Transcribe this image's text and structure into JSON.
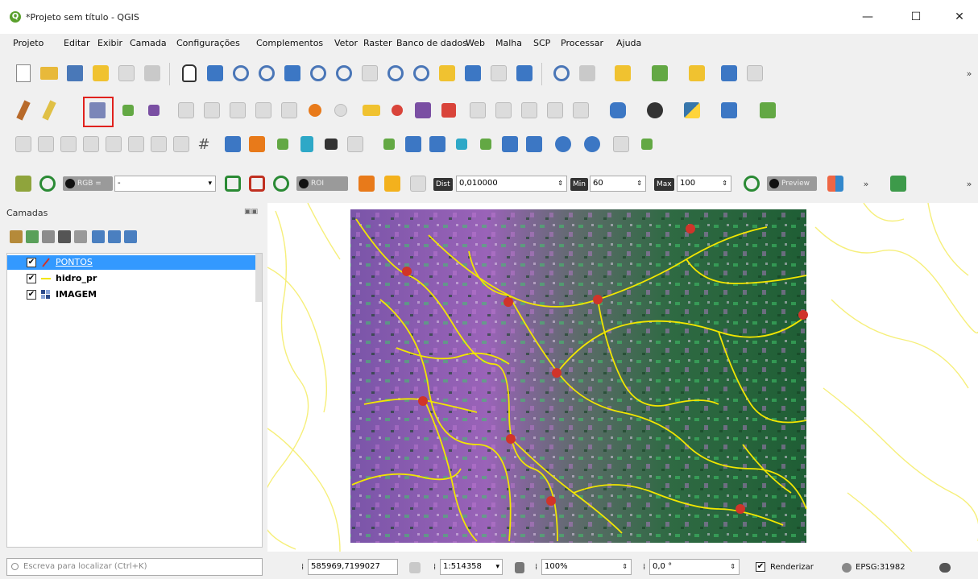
{
  "window": {
    "title": "*Projeto sem título - QGIS",
    "minimize": "—",
    "maximize": "☐",
    "close": "✕"
  },
  "menu": [
    "Projeto",
    "Editar",
    "Exibir",
    "Camada",
    "Configurações",
    "Complementos",
    "Vetor",
    "Raster",
    "Banco de dados",
    "Web",
    "Malha",
    "SCP",
    "Processar",
    "Ajuda"
  ],
  "scp_toolbar": {
    "rgb_label": "RGB =",
    "rgb_value": "-",
    "roi_label": "ROI",
    "dist_label": "Dist",
    "dist_value": "0,010000",
    "min_label": "Min",
    "min_value": "60",
    "max_label": "Max",
    "max_value": "100",
    "preview_label": "Preview",
    "more": "»"
  },
  "layers_panel": {
    "title": "Camadas",
    "layers": [
      {
        "name": "PONTOS",
        "checked": "✔",
        "selected": true
      },
      {
        "name": "hidro_pr",
        "checked": "✔"
      },
      {
        "name": "IMAGEM",
        "checked": "✔"
      }
    ]
  },
  "statusbar": {
    "locator_placeholder": "Escreva para localizar (Ctrl+K)",
    "coordinate": "585969,7199027",
    "scale": "1:514358",
    "magnifier": "100%",
    "rotation": "0,0 °",
    "render_label": "Renderizar",
    "render_checked": "✔",
    "crs": "EPSG:31982"
  },
  "colors": {
    "selection": "#3399ff",
    "rivers": "#f2e600",
    "points": "#d0342a",
    "highlight": "#e0211d"
  }
}
